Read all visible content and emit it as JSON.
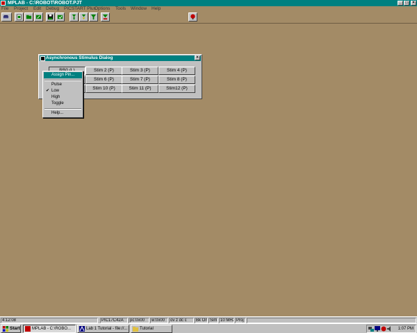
{
  "window": {
    "title": "MPLAB - C:\\ROBOT\\ROBOT.PJT",
    "minimize": "_",
    "maximize": "□",
    "close": "×"
  },
  "menu": [
    "File",
    "Project",
    "Edit",
    "Debug",
    "PICSTART Plus",
    "Options",
    "Tools",
    "Window",
    "Help"
  ],
  "toolbar": {
    "icons": [
      "project-icon",
      "new-file-icon",
      "open-file-icon",
      "edit-project-icon",
      "save-icon",
      "make-project-icon",
      "download-icon",
      "upload-icon",
      "filter-icon",
      "verify-icon",
      "red-light-icon"
    ]
  },
  "dialog": {
    "title": "Asynchronous Stimulus Dialog",
    "close": "×",
    "buttons": [
      [
        "RB0 (L)",
        "Stim 2 (P)",
        "Stim 3 (P)",
        "Stim 4 (P)"
      ],
      [
        "",
        "Stim 6 (P)",
        "Stim 7 (P)",
        "Stim 8 (P)"
      ],
      [
        "",
        "Stim 10 (P)",
        "Stim 11 (P)",
        "Stim12 (P)"
      ]
    ]
  },
  "context_menu": {
    "assign_pin": "Assign Pin...",
    "pulse": "Pulse",
    "low": "Low",
    "low_check": "✔",
    "high": "High",
    "toggle": "Toggle",
    "help": "Help..."
  },
  "status": {
    "time": "4:12:08",
    "processor": "PIC17C42A",
    "pc": "pc:0x00",
    "w": "w:0x00",
    "flags": "ov z dc c",
    "bk": "Bk On",
    "sim": "Sim",
    "freq": "10 MHz",
    "proj": "Proj"
  },
  "taskbar": {
    "start": "Start",
    "tasks": [
      "MPLAB - C:\\ROBO...",
      "Lab 1 Tutorial - file://...",
      "Tutorial"
    ],
    "clock": "1:07 PM"
  }
}
